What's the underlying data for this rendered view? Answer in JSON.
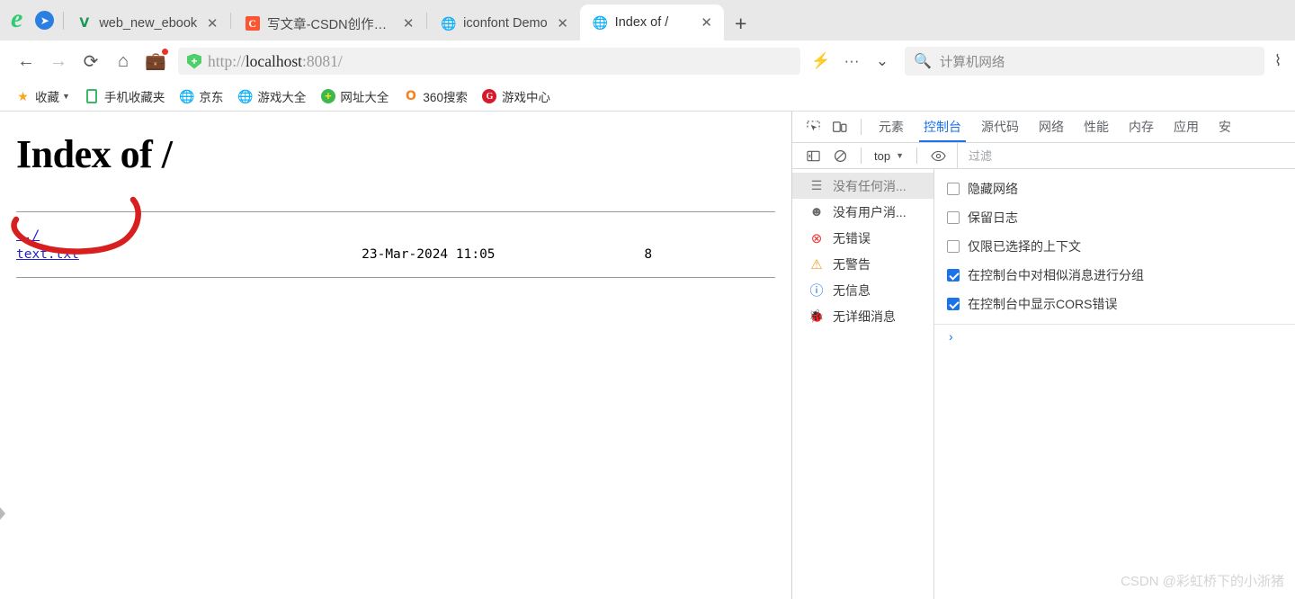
{
  "browser": {
    "logo_icon": "edge-e-logo",
    "plane_icon": "paper-plane-icon",
    "tabs": [
      {
        "title": "web_new_ebook",
        "favicon": "v-logo-icon",
        "active": false
      },
      {
        "title": "写文章-CSDN创作中心",
        "favicon": "csdn-c-icon",
        "active": false
      },
      {
        "title": "iconfont Demo",
        "favicon": "globe-icon",
        "active": false
      },
      {
        "title": "Index of /",
        "favicon": "globe-icon",
        "active": true
      }
    ],
    "new_tab_label": "+",
    "close_label": "✕"
  },
  "toolbar": {
    "back_icon": "←",
    "forward_icon": "→",
    "reload_icon": "⟳",
    "home_icon": "⌂",
    "briefcase_icon": "💼",
    "url": {
      "scheme": "http://",
      "host": "localhost",
      "rest": ":8081/",
      "shield_icon": "shield-plus-icon"
    },
    "lightning_icon": "⚡",
    "more_icon": "···",
    "chevron_icon": "⌄",
    "edge_icon": "⌇"
  },
  "search": {
    "icon": "search-icon",
    "value": "计算机网络"
  },
  "bookmarks": [
    {
      "label": "收藏",
      "icon": "star-icon",
      "caret": true
    },
    {
      "label": "手机收藏夹",
      "icon": "phone-icon"
    },
    {
      "label": "京东",
      "icon": "globe-icon"
    },
    {
      "label": "游戏大全",
      "icon": "globe-icon"
    },
    {
      "label": "网址大全",
      "icon": "green-plus-icon"
    },
    {
      "label": "360搜索",
      "icon": "orange-o-icon"
    },
    {
      "label": "游戏中心",
      "icon": "red-g-icon"
    }
  ],
  "page": {
    "heading": "Index of /",
    "rows": [
      {
        "name": "../",
        "date": "",
        "size": ""
      },
      {
        "name": "text.txt",
        "date": "23-Mar-2024 11:05",
        "size": "8"
      }
    ],
    "annotation_color": "#d81f1f"
  },
  "devtools": {
    "inspect_icon": "inspect-element-icon",
    "device_icon": "device-toolbar-icon",
    "tabs": [
      {
        "label": "元素",
        "active": false
      },
      {
        "label": "控制台",
        "active": true
      },
      {
        "label": "源代码",
        "active": false
      },
      {
        "label": "网络",
        "active": false
      },
      {
        "label": "性能",
        "active": false
      },
      {
        "label": "内存",
        "active": false
      },
      {
        "label": "应用",
        "active": false
      },
      {
        "label": "安",
        "active": false
      }
    ],
    "toolbar": {
      "sidebar_icon": "console-sidebar-icon",
      "clear_icon": "clear-console-icon",
      "context": "top",
      "context_caret": "▼",
      "eye_icon": "live-expression-icon",
      "filter_placeholder": "过滤"
    },
    "sidebar": [
      {
        "label": "没有任何消...",
        "icon": "list-icon",
        "selected": true
      },
      {
        "label": "没有用户消...",
        "icon": "user-message-icon",
        "selected": false
      },
      {
        "label": "无错误",
        "icon": "error-icon",
        "selected": false
      },
      {
        "label": "无警告",
        "icon": "warning-icon",
        "selected": false
      },
      {
        "label": "无信息",
        "icon": "info-icon",
        "selected": false
      },
      {
        "label": "无详细消息",
        "icon": "verbose-bug-icon",
        "selected": false
      }
    ],
    "settings": [
      {
        "label": "隐藏网络",
        "checked": false
      },
      {
        "label": "保留日志",
        "checked": false
      },
      {
        "label": "仅限已选择的上下文",
        "checked": false
      },
      {
        "label": "在控制台中对相似消息进行分组",
        "checked": true
      },
      {
        "label": "在控制台中显示CORS错误",
        "checked": true
      }
    ],
    "prompt_icon": "›",
    "accent_color": "#1a73e8"
  },
  "watermark": "CSDN @彩虹桥下的小浙猪"
}
